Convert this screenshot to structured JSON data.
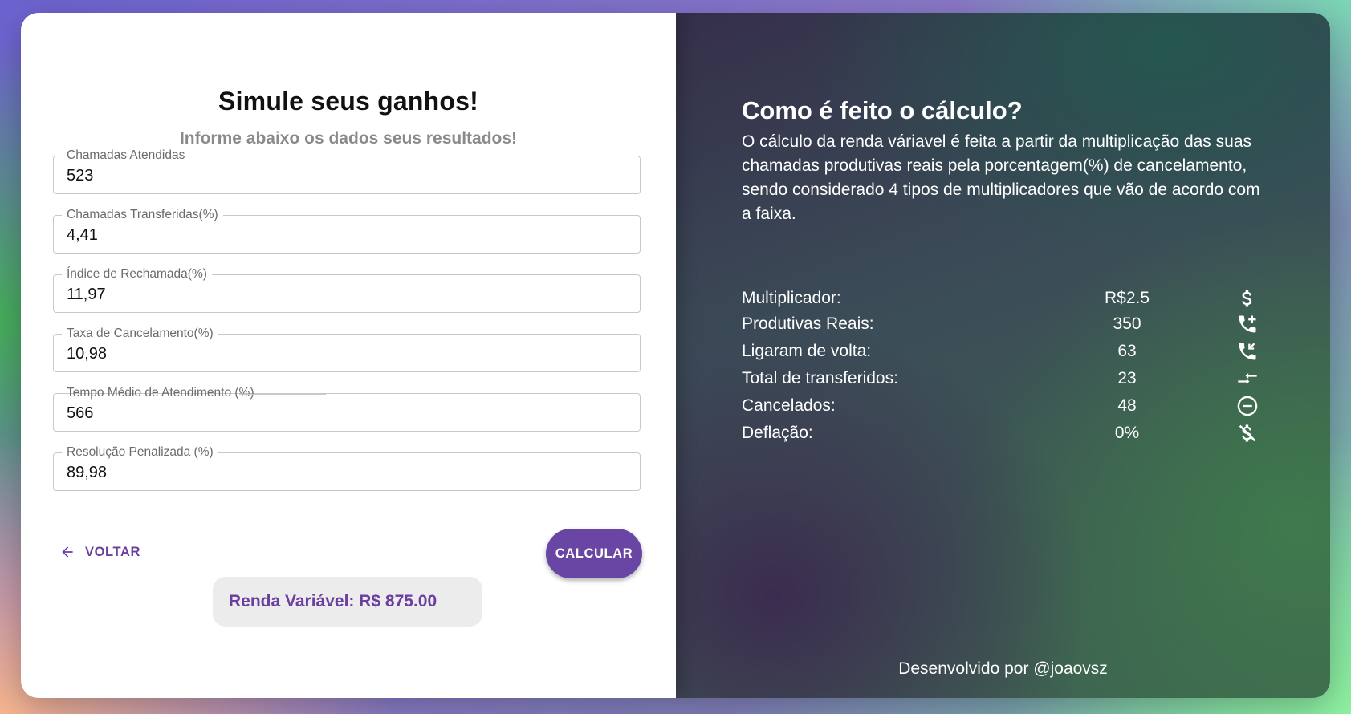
{
  "form": {
    "title": "Simule seus ganhos!",
    "subtitle": "Informe abaixo os dados seus resultados!",
    "fields": [
      {
        "label": "Chamadas Atendidas",
        "value": "523"
      },
      {
        "label": "Chamadas Transferidas(%)",
        "value": "4,41"
      },
      {
        "label": "Índice de Rechamada(%)",
        "value": "11,97"
      },
      {
        "label": "Taxa de Cancelamento(%)",
        "value": "10,98"
      },
      {
        "label": "Tempo Médio de Atendimento (%)",
        "value": "566"
      },
      {
        "label": "Resolução Penalizada (%)",
        "value": "89,98"
      }
    ],
    "back_label": "VOLTAR",
    "calc_label": "CALCULAR",
    "result": "Renda Variável: R$ 875.00"
  },
  "info": {
    "title": "Como é feito o cálculo?",
    "description": "O cálculo da renda váriavel é feita a partir da multiplicação das suas chamadas produtivas reais pela porcentagem(%) de cancelamento, sendo considerado 4 tipos de multiplicadores que vão de acordo com a faixa.",
    "rows": [
      {
        "label": "Multiplicador:",
        "value": "R$2.5",
        "icon": "dollar-icon"
      },
      {
        "label": "Produtivas Reais:",
        "value": "350",
        "icon": "phone-add-icon"
      },
      {
        "label": "Ligaram de volta:",
        "value": "63",
        "icon": "phone-callback-icon"
      },
      {
        "label": "Total de transferidos:",
        "value": "23",
        "icon": "transfer-arrows-icon"
      },
      {
        "label": "Cancelados:",
        "value": "48",
        "icon": "minus-circle-icon"
      },
      {
        "label": "Deflação:",
        "value": "0%",
        "icon": "money-off-icon"
      }
    ],
    "footer": "Desenvolvido por @joaovsz"
  },
  "colors": {
    "accent": "#6a46a4",
    "panel_dark": "#3b4c57"
  }
}
